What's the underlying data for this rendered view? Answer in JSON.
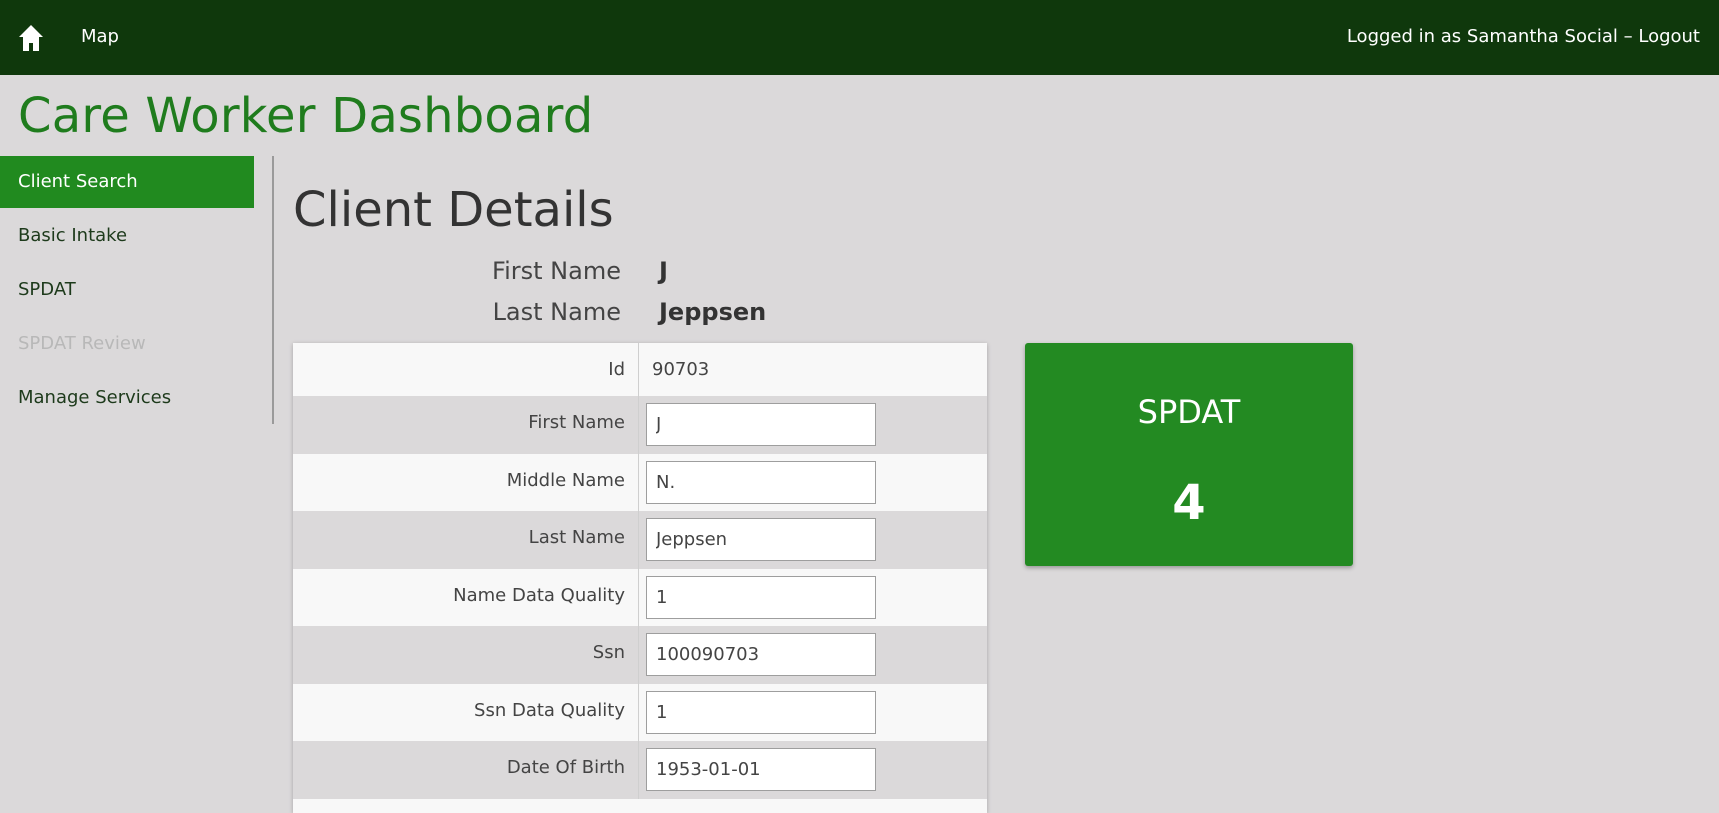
{
  "topbar": {
    "home_icon": "home-icon",
    "map_label": "Map",
    "logged_in_text": "Logged in as Samantha Social – ",
    "logout_label": "Logout"
  },
  "dashboard_title": "Care Worker Dashboard",
  "sidebar": {
    "items": [
      {
        "label": "Client Search",
        "state": "active"
      },
      {
        "label": "Basic Intake",
        "state": "normal"
      },
      {
        "label": "SPDAT",
        "state": "normal"
      },
      {
        "label": "SPDAT Review",
        "state": "disabled"
      },
      {
        "label": "Manage Services",
        "state": "normal"
      }
    ]
  },
  "page_title": "Client Details",
  "summary": {
    "first_name_label": "First Name",
    "first_name_value": "J",
    "last_name_label": "Last Name",
    "last_name_value": "Jeppsen"
  },
  "details": {
    "id_label": "Id",
    "id_value": "90703",
    "fields": [
      {
        "label": "First Name",
        "value": "J"
      },
      {
        "label": "Middle Name",
        "value": "N."
      },
      {
        "label": "Last Name",
        "value": "Jeppsen"
      },
      {
        "label": "Name Data Quality",
        "value": "1"
      },
      {
        "label": "Ssn",
        "value": "100090703"
      },
      {
        "label": "Ssn Data Quality",
        "value": "1"
      },
      {
        "label": "Date Of Birth",
        "value": "1953-01-01"
      }
    ]
  },
  "spdat_card": {
    "label": "SPDAT",
    "score": "4"
  },
  "colors": {
    "topbar": "#0f380c",
    "accent_green": "#238a22",
    "title_green": "#1f7c1d",
    "background": "#dbd9da"
  }
}
